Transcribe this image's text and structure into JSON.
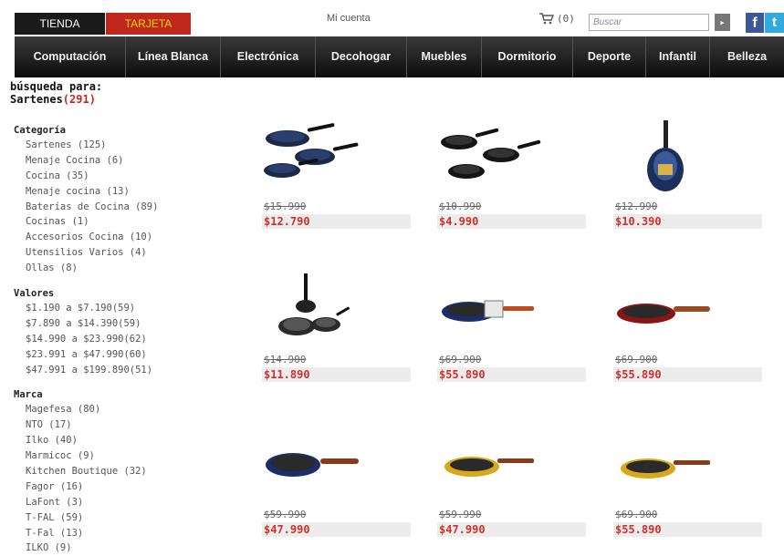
{
  "topbar": {
    "tab_tienda": "TIENDA",
    "tab_tarjeta": "TARJETA",
    "account_link": "Mi cuenta",
    "cart_count": "(0)",
    "search_placeholder": "Buscar",
    "search_button_icon": "arrow-right-icon",
    "facebook_label": "f",
    "twitter_label": "t"
  },
  "nav": {
    "items": [
      "Computación",
      "Línea Blanca",
      "Electrónica",
      "Decohogar",
      "Muebles",
      "Dormitorio",
      "Deporte",
      "Infantil",
      "Belleza"
    ]
  },
  "results": {
    "heading": "búsqueda para:",
    "query": "Sartenes",
    "count": "(291)"
  },
  "sidebar": {
    "categoria_title": "Categoría",
    "categoria_items": [
      "Sartenes (125)",
      "Menaje Cocina (6)",
      "Cocina (35)",
      "Menaje cocina (13)",
      "Baterías de Cocina (89)",
      "Cocinas (1)",
      "Accesorios Cocina (10)",
      "Utensilios Varios (4)",
      "Ollas (8)"
    ],
    "valores_title": "Valores",
    "valores_items": [
      "$1.190 a $7.190(59)",
      "$7.890 a $14.390(59)",
      "$14.990 a $23.990(62)",
      "$23.991 a $47.990(60)",
      "$47.991 a $199.890(51)"
    ],
    "marca_title": "Marca",
    "marca_items": [
      "Magefesa (80)",
      "NTO (17)",
      "Ilko (40)",
      "Marmicoc (9)",
      "Kitchen Boutique (32)",
      "Fagor (16)",
      "LaFont (3)",
      "T-FAL (59)",
      "T-Fal (13)",
      "ILKO (9)"
    ]
  },
  "products": [
    {
      "old_price": "$15.990",
      "price": "$12.790",
      "image": "three-frying-pans-set"
    },
    {
      "old_price": "$10.990",
      "price": "$4.990",
      "image": "three-frying-pans-set"
    },
    {
      "old_price": "$12.990",
      "price": "$10.390",
      "image": "frying-pan-boxed"
    },
    {
      "old_price": "$14.900",
      "price": "$11.890",
      "image": "pan-set-stacked"
    },
    {
      "old_price": "$69.900",
      "price": "$55.890",
      "image": "blue-frying-pan"
    },
    {
      "old_price": "$69.900",
      "price": "$55.890",
      "image": "red-frying-pan"
    },
    {
      "old_price": "$59.990",
      "price": "$47.990",
      "image": "blue-frying-pan"
    },
    {
      "old_price": "$59.990",
      "price": "$47.990",
      "image": "yellow-frying-pan"
    },
    {
      "old_price": "$69.900",
      "price": "$55.890",
      "image": "yellow-frying-pan"
    }
  ],
  "colors": {
    "accent_red": "#c0281e",
    "price_red": "#d0302a",
    "nav_dark": "#1a1a1a",
    "tarjeta_text": "#f5d400"
  }
}
